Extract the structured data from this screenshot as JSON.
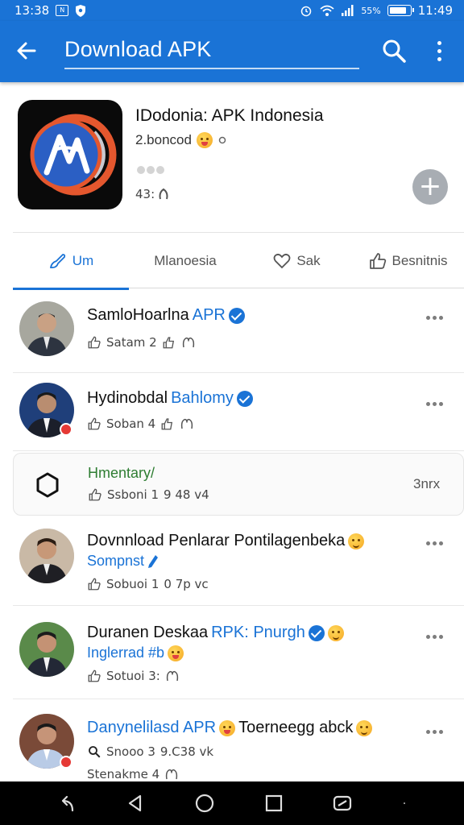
{
  "status_bar": {
    "time_left": "13:38",
    "box_glyph": "N",
    "signal": "55%",
    "time_right": "11:49"
  },
  "app_bar": {
    "title": "Download APK",
    "back_icon": "arrow-left-icon",
    "search_icon": "search-icon",
    "more_icon": "more-vert-icon"
  },
  "app_info": {
    "name": "IDodonia: APK Indonesia",
    "subtitle": "2.boncod",
    "meta": "43:"
  },
  "tabs": [
    {
      "label": "Um",
      "icon": "brush-icon",
      "active": true
    },
    {
      "label": "Mlanoesia",
      "icon": "",
      "active": false
    },
    {
      "label": "Sak",
      "icon": "heart-icon",
      "active": false
    },
    {
      "label": "Besnitnis",
      "icon": "thumb-up-icon",
      "active": false
    }
  ],
  "posts": [
    {
      "title": "SamloHoarlna",
      "title_accent": "APR",
      "verified": true,
      "meta": "Satam 2",
      "meta_extra": ""
    },
    {
      "title": "Hydinobdal",
      "title_accent": "Bahlomy",
      "verified": true,
      "meta": "Soban 4",
      "meta_extra": ""
    },
    {
      "title": "",
      "title_accent": "",
      "verified": false,
      "subtitle": "Hmentary/",
      "meta": "Ssboni 1",
      "meta_extra": "9 48 v4",
      "side_text": "3nrx"
    },
    {
      "title": "Dovnnload Penlarar Pontilagenbeka",
      "title_accent": "",
      "verified": false,
      "subtitle": "Sompnst",
      "meta": "Sobuoi 1",
      "meta_extra": "0 7p vc"
    },
    {
      "title": "Duranen Deskaa",
      "title_accent": "RPK: Pnurgh",
      "verified": true,
      "subtitle": "Inglerrad #b",
      "meta": "Sotuoi 3:",
      "meta_extra": ""
    },
    {
      "title_prefix": "Danynelilasd APR",
      "title": "Toerneegg abck",
      "title_accent": "",
      "verified": false,
      "meta": "Snooo 3",
      "meta_extra": "9.C38 vk",
      "meta2": "Stenakme 4"
    }
  ],
  "colors": {
    "primary": "#1a73d6",
    "green_text": "#2e7d32",
    "nav_bg": "#000000"
  }
}
